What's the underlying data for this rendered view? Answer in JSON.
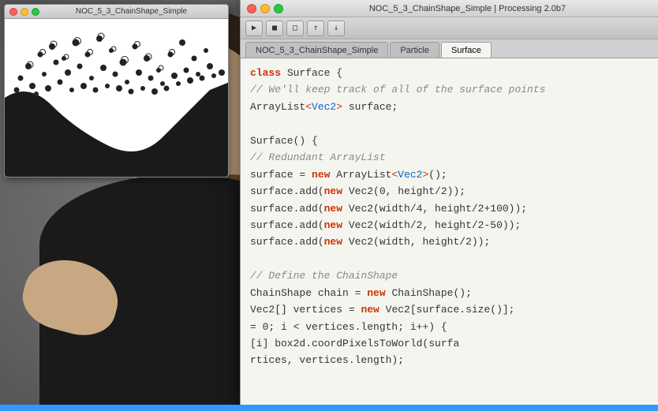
{
  "window": {
    "title": "NOC_5_3_ChainShape_Simple | Processing 2.0b7",
    "buttons": {
      "close_label": "×",
      "min_label": "–",
      "max_label": "+"
    }
  },
  "toolbar": {
    "buttons": [
      "▶",
      "■",
      "⬤",
      "❏",
      "❐"
    ]
  },
  "tabs": [
    {
      "label": "NOC_5_3_ChainShape_Simple",
      "active": false
    },
    {
      "label": "Particle",
      "active": false
    },
    {
      "label": "Surface",
      "active": true
    }
  ],
  "sketch_window": {
    "title": "NOC_5_3_ChainShape_Simple"
  },
  "code": [
    {
      "parts": [
        {
          "text": "class ",
          "style": "kw"
        },
        {
          "text": "Surface {",
          "style": "normal"
        }
      ]
    },
    {
      "parts": [
        {
          "text": "  // We'll keep track of all of the surface points",
          "style": "comment"
        }
      ]
    },
    {
      "parts": [
        {
          "text": "  ArrayList",
          "style": "normal"
        },
        {
          "text": "<",
          "style": "normal"
        },
        {
          "text": "Vec2",
          "style": "type"
        },
        {
          "text": "> surface;",
          "style": "normal"
        }
      ]
    },
    {
      "parts": [
        {
          "text": "",
          "style": "normal"
        }
      ]
    },
    {
      "parts": [
        {
          "text": "  Surface() {",
          "style": "normal"
        }
      ]
    },
    {
      "parts": [
        {
          "text": "  // Redundant ArrayList",
          "style": "comment"
        }
      ]
    },
    {
      "parts": [
        {
          "text": "  surface = ",
          "style": "normal"
        },
        {
          "text": "new ",
          "style": "kw"
        },
        {
          "text": "ArrayList",
          "style": "normal"
        },
        {
          "text": "<",
          "style": "normal"
        },
        {
          "text": "Vec2",
          "style": "type"
        },
        {
          "text": ">();",
          "style": "normal"
        }
      ]
    },
    {
      "parts": [
        {
          "text": "  surface.add(",
          "style": "normal"
        },
        {
          "text": "new ",
          "style": "kw"
        },
        {
          "text": "Vec2(0, height/2));",
          "style": "normal"
        }
      ]
    },
    {
      "parts": [
        {
          "text": "  surface.add(",
          "style": "normal"
        },
        {
          "text": "new ",
          "style": "kw"
        },
        {
          "text": "Vec2(width/4, height/2+100));",
          "style": "normal"
        }
      ]
    },
    {
      "parts": [
        {
          "text": "  surface.add(",
          "style": "normal"
        },
        {
          "text": "new ",
          "style": "kw"
        },
        {
          "text": "Vec2(width/2, height/2-50));",
          "style": "normal"
        }
      ]
    },
    {
      "parts": [
        {
          "text": "  surface.add(",
          "style": "normal"
        },
        {
          "text": "new ",
          "style": "kw"
        },
        {
          "text": "Vec2(width, height/2));",
          "style": "normal"
        }
      ]
    },
    {
      "parts": [
        {
          "text": "",
          "style": "normal"
        }
      ]
    },
    {
      "parts": [
        {
          "text": "  // Define the ChainShape",
          "style": "comment"
        }
      ]
    },
    {
      "parts": [
        {
          "text": "  ChainShape chain = ",
          "style": "normal"
        },
        {
          "text": "new ",
          "style": "kw"
        },
        {
          "text": "ChainShape();",
          "style": "normal"
        }
      ]
    },
    {
      "parts": [
        {
          "text": "  Vec2[] vertices = ",
          "style": "normal"
        },
        {
          "text": "new ",
          "style": "kw"
        },
        {
          "text": "Vec2[surface.size()];",
          "style": "normal"
        }
      ]
    },
    {
      "parts": [
        {
          "text": "  = 0; i < vertices.length; i++) {",
          "style": "normal"
        }
      ]
    },
    {
      "parts": [
        {
          "text": "  [i]  box2d.coordPixelsToWorld(surfa",
          "style": "normal"
        }
      ]
    },
    {
      "parts": [
        {
          "text": "    rtices, vertices.length);",
          "style": "normal"
        }
      ]
    }
  ]
}
